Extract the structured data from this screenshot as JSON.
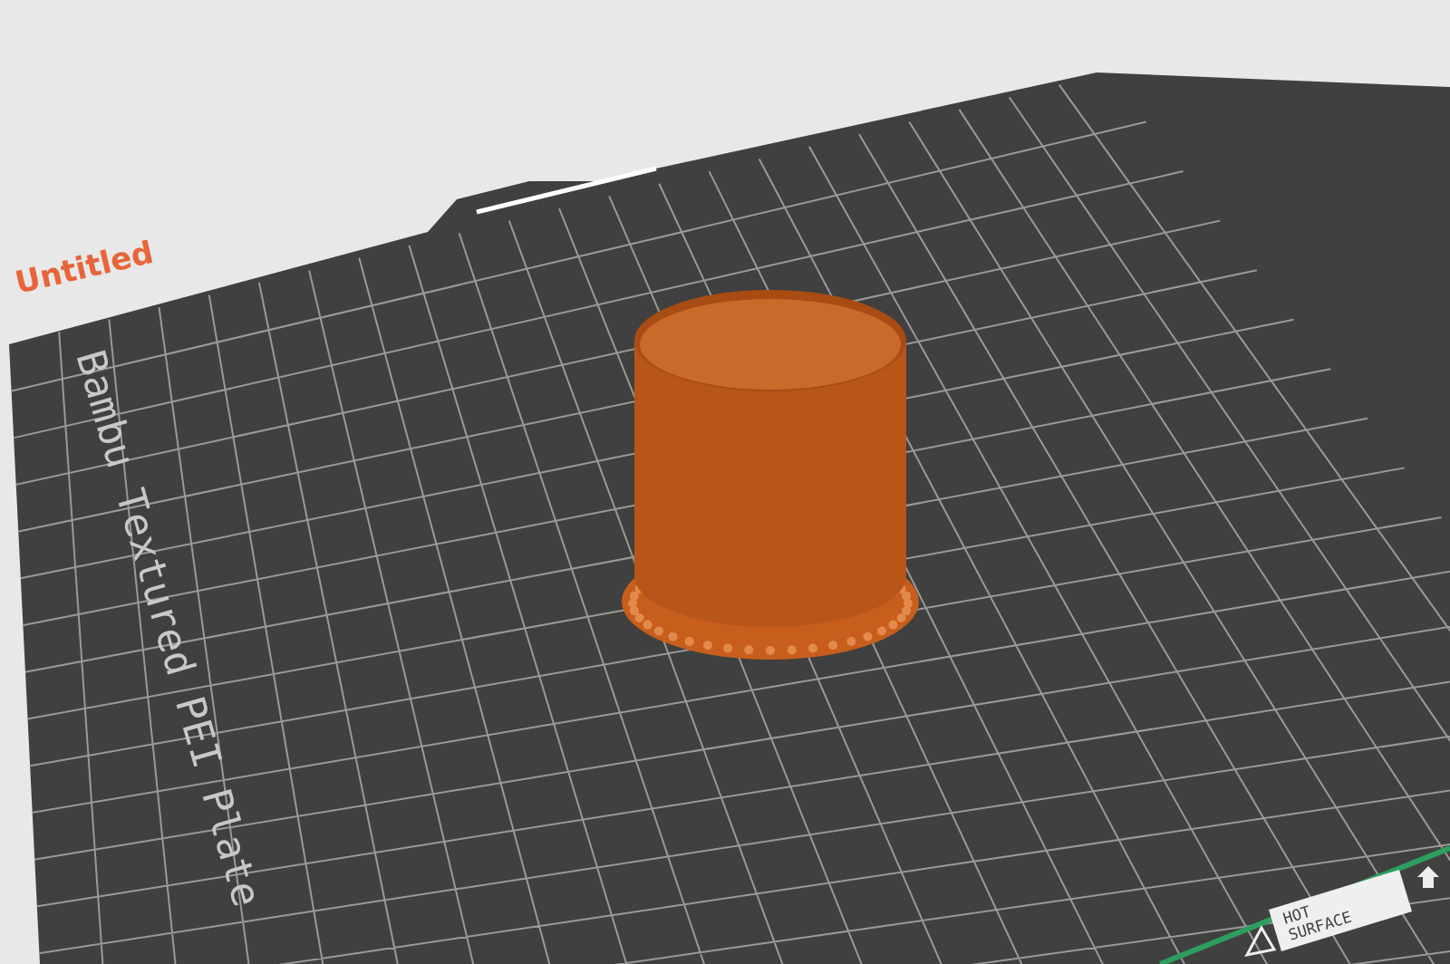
{
  "viewport": {
    "project_name": "Untitled",
    "plate_label": "Bambu Textured PEI Plate",
    "warning_lines": [
      "HOT",
      "SURFACE"
    ]
  }
}
